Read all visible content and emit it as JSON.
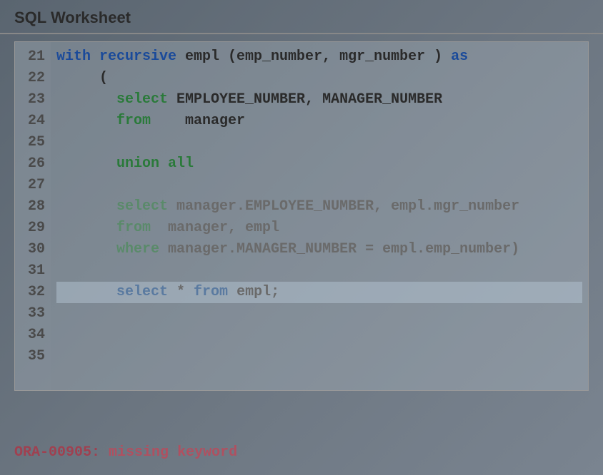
{
  "header": {
    "title": "SQL Worksheet"
  },
  "editor": {
    "startLine": 21,
    "lines": [
      {
        "segments": [
          {
            "t": "with recursive",
            "c": "kw-blue"
          },
          {
            "t": " empl (emp_number, mgr_number ) ",
            "c": "id-dark"
          },
          {
            "t": "as",
            "c": "kw-blue"
          }
        ]
      },
      {
        "segments": [
          {
            "t": "     (",
            "c": "id-dark"
          }
        ]
      },
      {
        "segments": [
          {
            "t": "       ",
            "c": ""
          },
          {
            "t": "select",
            "c": "kw-green"
          },
          {
            "t": " EMPLOYEE_NUMBER, MANAGER_NUMBER",
            "c": "id-dark"
          }
        ]
      },
      {
        "segments": [
          {
            "t": "       ",
            "c": ""
          },
          {
            "t": "from",
            "c": "kw-green"
          },
          {
            "t": "    manager",
            "c": "id-dark"
          }
        ]
      },
      {
        "segments": []
      },
      {
        "segments": [
          {
            "t": "       ",
            "c": ""
          },
          {
            "t": "union all",
            "c": "kw-green"
          }
        ]
      },
      {
        "segments": []
      },
      {
        "segments": [
          {
            "t": "       ",
            "c": ""
          },
          {
            "t": "select",
            "c": "faded-green"
          },
          {
            "t": " manager.EMPLOYEE_NUMBER, empl.mgr_number",
            "c": "faded-text"
          }
        ]
      },
      {
        "segments": [
          {
            "t": "       ",
            "c": ""
          },
          {
            "t": "from",
            "c": "faded-green"
          },
          {
            "t": "  manager, empl",
            "c": "faded-text"
          }
        ]
      },
      {
        "segments": [
          {
            "t": "       ",
            "c": ""
          },
          {
            "t": "where",
            "c": "faded-green"
          },
          {
            "t": " manager.MANAGER_NUMBER = empl.emp_number)",
            "c": "faded-text"
          }
        ]
      },
      {
        "segments": []
      },
      {
        "highlighted": true,
        "segments": [
          {
            "t": "       ",
            "c": ""
          },
          {
            "t": "select",
            "c": "faded-blue"
          },
          {
            "t": " * ",
            "c": "faded-text"
          },
          {
            "t": "from",
            "c": "faded-blue"
          },
          {
            "t": " empl;",
            "c": "faded-text"
          }
        ]
      },
      {
        "segments": []
      },
      {
        "segments": []
      },
      {
        "segments": []
      }
    ]
  },
  "error": {
    "code": "ORA-00905:",
    "message": "missing keyword"
  }
}
